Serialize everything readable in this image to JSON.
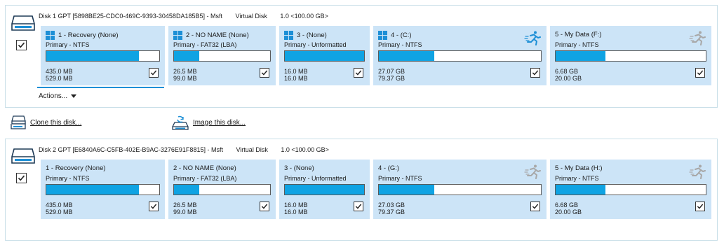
{
  "disks": [
    {
      "header": {
        "name": "Disk 1 GPT [5898BE25-CDC0-469C-9393-30458DA185B5] - Msft",
        "type": "Virtual Disk",
        "size": "1.0  <100.00 GB>"
      },
      "partitions": [
        {
          "title": "1 - Recovery (None)",
          "type": "Primary - NTFS",
          "used": "435.0 MB",
          "total": "529.0 MB",
          "fill": 0.82,
          "win_icon": true,
          "runner": ""
        },
        {
          "title": "2 - NO NAME (None)",
          "type": "Primary - FAT32 (LBA)",
          "used": "26.5 MB",
          "total": "99.0 MB",
          "fill": 0.26,
          "win_icon": true,
          "runner": ""
        },
        {
          "title": "3 -  (None)",
          "type": "Primary - Unformatted",
          "used": "16.0 MB",
          "total": "16.0 MB",
          "fill": 1.0,
          "win_icon": true,
          "runner": ""
        },
        {
          "title": "4 -  (C:)",
          "type": "Primary - NTFS",
          "used": "27.07 GB",
          "total": "79.37 GB",
          "fill": 0.34,
          "win_icon": true,
          "runner": "active"
        },
        {
          "title": "5 - My Data (F:)",
          "type": "Primary - NTFS",
          "used": "6.68 GB",
          "total": "20.00 GB",
          "fill": 0.33,
          "win_icon": false,
          "runner": "inactive"
        }
      ]
    },
    {
      "header": {
        "name": "Disk 2 GPT [E6840A6C-C5FB-402E-B9AC-3276E91F8815] - Msft",
        "type": "Virtual Disk",
        "size": "1.0  <100.00 GB>"
      },
      "partitions": [
        {
          "title": "1 - Recovery (None)",
          "type": "Primary - NTFS",
          "used": "435.0 MB",
          "total": "529.0 MB",
          "fill": 0.82,
          "win_icon": false,
          "runner": ""
        },
        {
          "title": "2 - NO NAME (None)",
          "type": "Primary - FAT32 (LBA)",
          "used": "26.5 MB",
          "total": "99.0 MB",
          "fill": 0.26,
          "win_icon": false,
          "runner": ""
        },
        {
          "title": "3 -  (None)",
          "type": "Primary - Unformatted",
          "used": "16.0 MB",
          "total": "16.0 MB",
          "fill": 1.0,
          "win_icon": false,
          "runner": ""
        },
        {
          "title": "4 -  (G:)",
          "type": "Primary - NTFS",
          "used": "27.03 GB",
          "total": "79.37 GB",
          "fill": 0.34,
          "win_icon": false,
          "runner": "inactive"
        },
        {
          "title": "5 - My Data (H:)",
          "type": "Primary - NTFS",
          "used": "6.68 GB",
          "total": "20.00 GB",
          "fill": 0.33,
          "win_icon": false,
          "runner": "inactive"
        }
      ]
    }
  ],
  "actions_label": "Actions...",
  "clone_label": "Clone this disk...",
  "image_label": "Image this disk...",
  "colors": {
    "bar_fill": "#0fa3e3",
    "partition_bg": "#cce4f7",
    "active_runner": "#1d8fd6",
    "inactive_runner": "#a8a8a8"
  }
}
